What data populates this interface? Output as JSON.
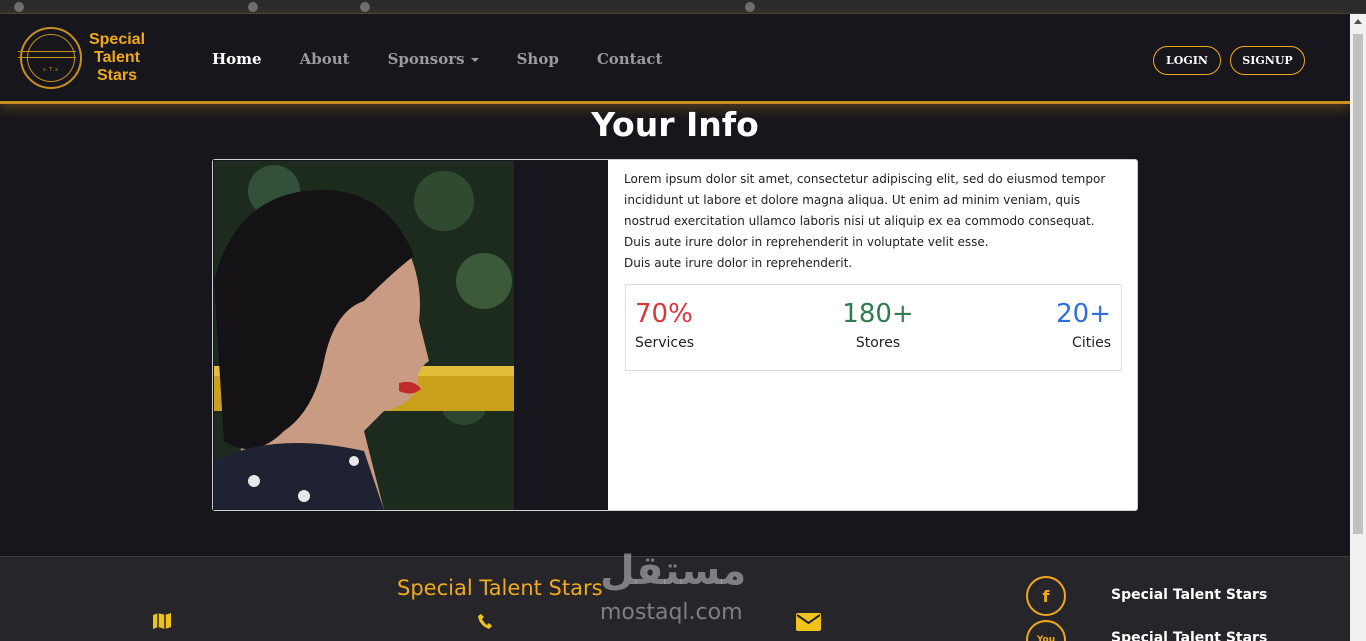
{
  "nav": {
    "brand": "Special Talent Stars",
    "brand_lines": [
      "Special",
      "Talent",
      "Stars"
    ],
    "logo_text": "s.T.s",
    "items": [
      {
        "label": "Home",
        "active": true
      },
      {
        "label": "About",
        "active": false
      },
      {
        "label": "Sponsors",
        "active": false,
        "dropdown": true
      },
      {
        "label": "Shop",
        "active": false
      },
      {
        "label": "Contact",
        "active": false
      }
    ],
    "login_label": "LOGIN",
    "signup_label": "SIGNUP"
  },
  "main": {
    "title": "Your Info",
    "bio": "Lorem ipsum dolor sit amet, consectetur adipiscing elit, sed do eiusmod tempor incididunt ut labore et dolore magna aliqua. Ut enim ad minim veniam, quis nostrud exercitation ullamco laboris nisi ut aliquip ex ea commodo consequat. Duis aute irure dolor in reprehenderit in voluptate velit esse.",
    "bio_extra": "Duis aute irure dolor in reprehenderit.",
    "stats": [
      {
        "value": "70%",
        "label": "Services",
        "color": "#d9363e"
      },
      {
        "value": "180+",
        "label": "Stores",
        "color": "#2e7d4f"
      },
      {
        "value": "20+",
        "label": "Cities",
        "color": "#2f6fdb"
      }
    ]
  },
  "footer": {
    "brand": "Special Talent Stars",
    "icons": [
      "map-icon",
      "phone-icon",
      "envelope-icon"
    ],
    "social": [
      {
        "icon": "facebook-icon",
        "glyph": "f",
        "label": "Special Talent Stars"
      },
      {
        "icon": "youtube-icon",
        "glyph": "You",
        "label": "Special Talent Stars"
      }
    ]
  },
  "watermark": {
    "arabic": "مستقل",
    "latin": "mostaql.com"
  },
  "colors": {
    "accent": "#f0a91a",
    "background": "#17161d",
    "footer": "#26252a"
  }
}
